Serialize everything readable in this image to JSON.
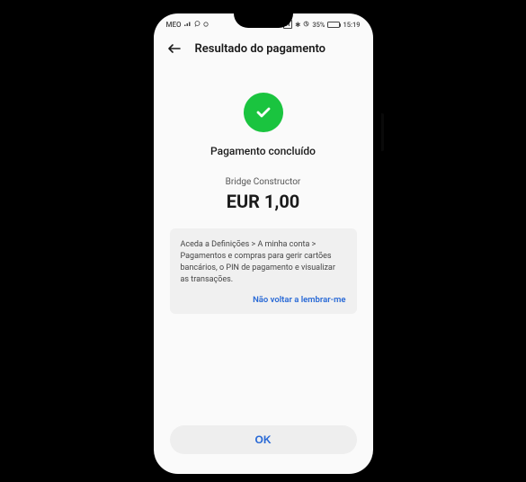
{
  "statusBar": {
    "carrier": "MEO",
    "signalIcons": "⁴ᴳ",
    "nfc": "N",
    "bluetooth": "✱",
    "batteryPercent": "35%",
    "time": "15:19"
  },
  "header": {
    "title": "Resultado do pagamento"
  },
  "result": {
    "status": "Pagamento concluído",
    "product": "Bridge Constructor",
    "amount": "EUR 1,00"
  },
  "infoBox": {
    "message": "Aceda a Definições > A minha conta > Pagamentos e compras para gerir cartões bancários, o PIN de pagamento e visualizar as transações.",
    "dismissLabel": "Não voltar a lembrar-me"
  },
  "actions": {
    "okLabel": "OK"
  }
}
